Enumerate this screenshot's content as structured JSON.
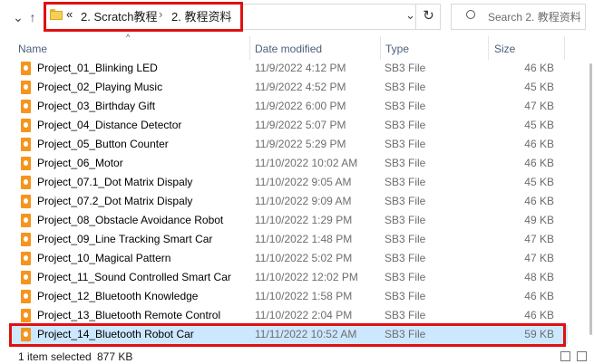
{
  "address": {
    "overflow_label": "«",
    "crumbs": [
      "2. Scratch教程",
      "2. 教程资料"
    ],
    "separator": "›",
    "search_placeholder": "Search 2. 教程资料"
  },
  "columns": {
    "name": "Name",
    "date": "Date modified",
    "type": "Type",
    "size": "Size"
  },
  "files": [
    {
      "name": "Project_01_Blinking LED",
      "date": "11/9/2022 4:12 PM",
      "type": "SB3 File",
      "size": "46 KB"
    },
    {
      "name": "Project_02_Playing Music",
      "date": "11/9/2022 4:52 PM",
      "type": "SB3 File",
      "size": "45 KB"
    },
    {
      "name": "Project_03_Birthday Gift",
      "date": "11/9/2022 6:00 PM",
      "type": "SB3 File",
      "size": "47 KB"
    },
    {
      "name": "Project_04_Distance Detector",
      "date": "11/9/2022 5:07 PM",
      "type": "SB3 File",
      "size": "45 KB"
    },
    {
      "name": "Project_05_Button Counter",
      "date": "11/9/2022 5:29 PM",
      "type": "SB3 File",
      "size": "46 KB"
    },
    {
      "name": "Project_06_Motor",
      "date": "11/10/2022 10:02 AM",
      "type": "SB3 File",
      "size": "46 KB"
    },
    {
      "name": "Project_07.1_Dot Matrix Dispaly",
      "date": "11/10/2022 9:05 AM",
      "type": "SB3 File",
      "size": "45 KB"
    },
    {
      "name": "Project_07.2_Dot Matrix Dispaly",
      "date": "11/10/2022 9:09 AM",
      "type": "SB3 File",
      "size": "46 KB"
    },
    {
      "name": "Project_08_Obstacle Avoidance Robot",
      "date": "11/10/2022 1:29 PM",
      "type": "SB3 File",
      "size": "49 KB"
    },
    {
      "name": "Project_09_Line Tracking Smart Car",
      "date": "11/10/2022 1:48 PM",
      "type": "SB3 File",
      "size": "47 KB"
    },
    {
      "name": "Project_10_Magical Pattern",
      "date": "11/10/2022 5:02 PM",
      "type": "SB3 File",
      "size": "47 KB"
    },
    {
      "name": "Project_11_Sound Controlled Smart Car",
      "date": "11/10/2022 12:02 PM",
      "type": "SB3 File",
      "size": "48 KB"
    },
    {
      "name": "Project_12_Bluetooth Knowledge",
      "date": "11/10/2022 1:58 PM",
      "type": "SB3 File",
      "size": "46 KB"
    },
    {
      "name": "Project_13_Bluetooth Remote Control",
      "date": "11/10/2022 2:04 PM",
      "type": "SB3 File",
      "size": "46 KB"
    },
    {
      "name": "Project_14_Bluetooth Robot Car",
      "date": "11/11/2022 10:52 AM",
      "type": "SB3 File",
      "size": "59 KB",
      "selected": true
    }
  ],
  "status": {
    "count": "1 item selected",
    "size": "877 KB"
  },
  "colors": {
    "highlight": "#e01010",
    "selection": "#cce8ff",
    "file_icon": "#f7941d"
  }
}
